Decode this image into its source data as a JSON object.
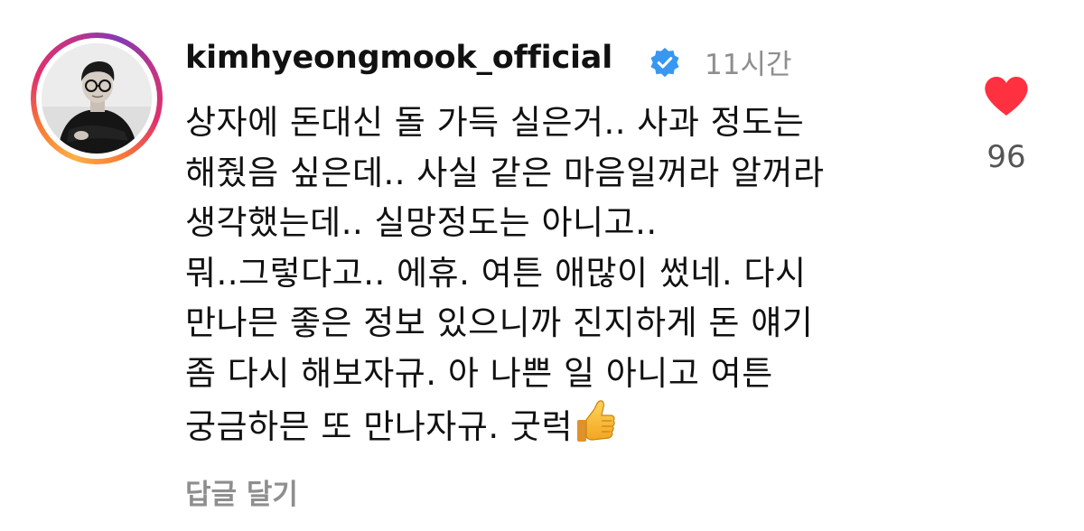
{
  "comment": {
    "username": "kimhyeongmook_official",
    "verified_icon": "verified-badge-icon",
    "verified_color": "#3897f0",
    "time": "11시간",
    "lines": [
      "상자에 돈대신 돌 가득 실은거.. 사과 정도는",
      "해줬음 싶은데.. 사실 같은 마음일꺼라 알꺼라",
      "생각했는데.. 실망정도는 아니고..",
      "뭐..그렇다고.. 에휴. 여튼 애많이 썼네. 다시",
      "만나믄 좋은 정보 있으니까 진지하게 돈 얘기",
      "좀 다시 해보자규. 아 나쁜 일 아니고 여튼",
      "궁금하믄 또 만나자규. 굿럭"
    ],
    "emoji": "thumbs-up-icon",
    "reply_label": "답글 달기",
    "like_icon": "heart-icon",
    "like_color": "#ff3040",
    "like_count": "96"
  }
}
